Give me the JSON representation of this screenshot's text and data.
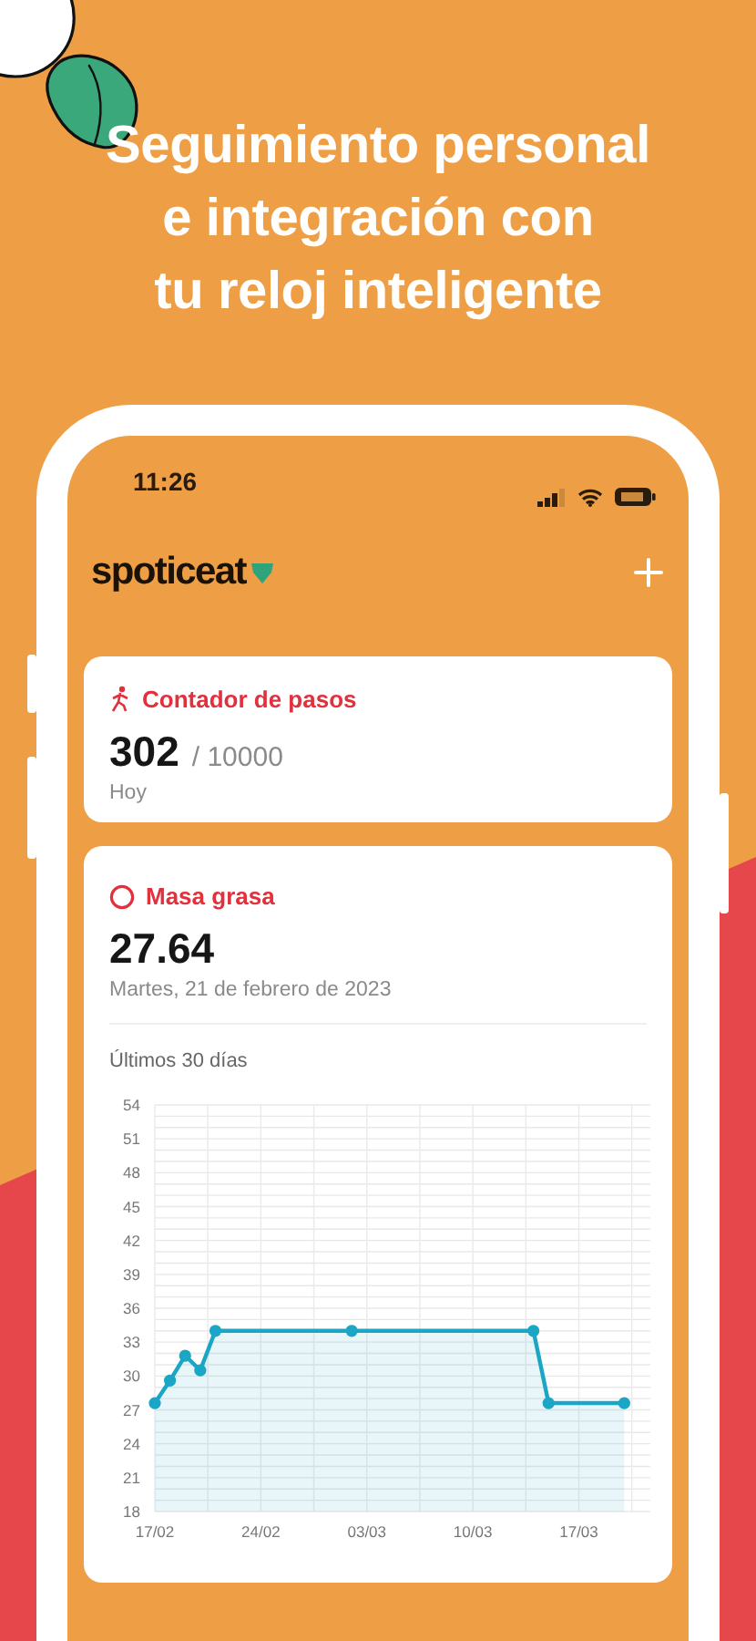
{
  "headline": {
    "lines": [
      "Seguimiento personal",
      "e integración con",
      "tu reloj inteligente"
    ]
  },
  "status_bar": {
    "time": "11:26"
  },
  "app_bar": {
    "logo": "spoticeat"
  },
  "steps_card": {
    "title": "Contador de pasos",
    "value": "302",
    "goal": "/ 10000",
    "period": "Hoy"
  },
  "fat_card": {
    "title": "Masa grasa",
    "value": "27.64",
    "date": "Martes, 21 de febrero de 2023",
    "range_label": "Últimos 30 días",
    "chart_data": {
      "type": "area",
      "categories": [
        "17/02",
        null,
        null,
        null,
        null,
        null,
        null,
        "24/02",
        null,
        null,
        null,
        null,
        null,
        null,
        "03/03",
        null,
        null,
        null,
        null,
        null,
        null,
        "10/03",
        null,
        null,
        null,
        null,
        null,
        null,
        "17/03",
        null,
        null,
        null
      ],
      "series": [
        {
          "color": "#1aa6c4",
          "values": [
            27.6,
            29.6,
            31.8,
            30.5,
            34,
            null,
            null,
            null,
            null,
            null,
            null,
            null,
            null,
            34,
            null,
            null,
            null,
            null,
            null,
            null,
            null,
            null,
            null,
            null,
            null,
            34,
            27.6,
            null,
            null,
            null,
            null,
            27.6
          ]
        }
      ],
      "ylim": [
        18,
        54
      ],
      "grid": true,
      "yticks": [
        18,
        21,
        24,
        27,
        30,
        33,
        36,
        39,
        42,
        45,
        48,
        51,
        54
      ]
    }
  }
}
